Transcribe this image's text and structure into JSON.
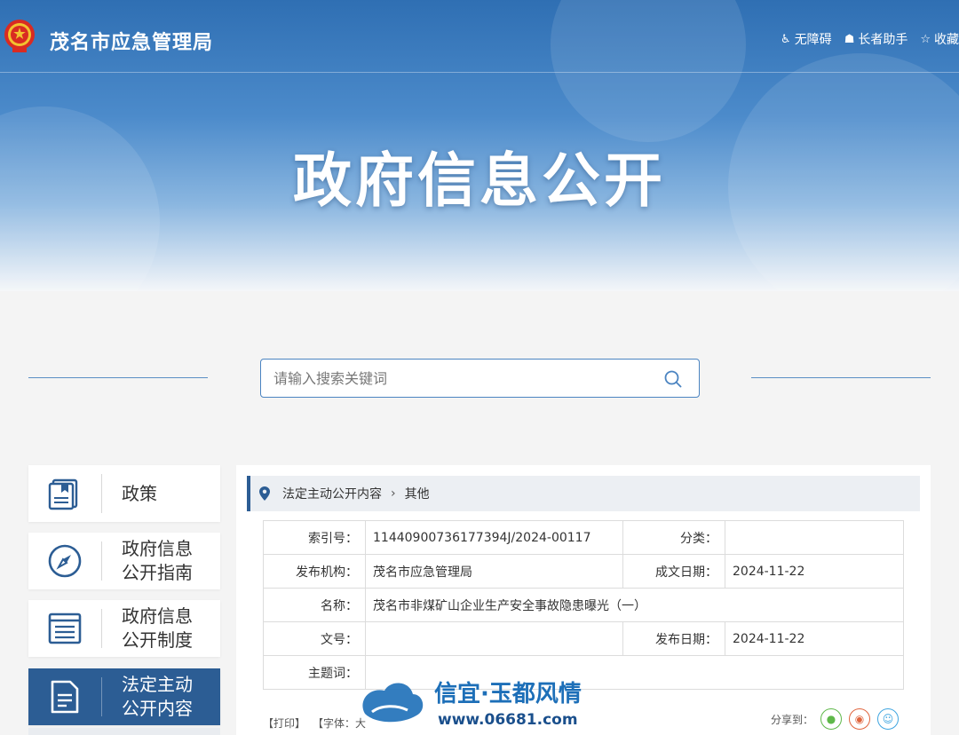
{
  "header": {
    "site_name": "茂名市应急管理局",
    "tools": [
      {
        "icon": "wheelchair-icon",
        "label": "无障碍"
      },
      {
        "icon": "elder-helper-icon",
        "label": "长者助手"
      },
      {
        "icon": "star-icon",
        "label": "收藏"
      }
    ]
  },
  "banner": {
    "title": "政府信息公开"
  },
  "search": {
    "placeholder": "请输入搜索关键词"
  },
  "sidebar": {
    "items": [
      {
        "label": "政策",
        "icon": "policy-book-icon"
      },
      {
        "label": "政府信息公开指南",
        "line1": "政府信息",
        "line2": "公开指南",
        "icon": "compass-icon"
      },
      {
        "label": "政府信息公开制度",
        "line1": "政府信息",
        "line2": "公开制度",
        "icon": "list-doc-icon"
      },
      {
        "label": "法定主动公开内容",
        "line1": "法定主动",
        "line2": "公开内容",
        "icon": "document-icon",
        "active": true
      }
    ]
  },
  "breadcrumb": {
    "level1": "法定主动公开内容",
    "level2": "其他"
  },
  "meta": {
    "index_label": "索引号：",
    "index_value": "11440900736177394J/2024-00117",
    "category_label": "分类：",
    "category_value": "",
    "publisher_label": "发布机构：",
    "publisher_value": "茂名市应急管理局",
    "created_label": "成文日期：",
    "created_value": "2024-11-22",
    "name_label": "名称：",
    "name_value": "茂名市非煤矿山企业生产安全事故隐患曝光（一）",
    "docno_label": "文号：",
    "docno_value": "",
    "published_label": "发布日期：",
    "published_value": "2024-11-22",
    "subject_label": "主题词：",
    "subject_value": ""
  },
  "footer": {
    "print": "【打印】",
    "font": "【字体：大",
    "share_label": "分享到："
  },
  "watermark": {
    "line1": "信宜·玉都风情",
    "line2": "www.06681.com"
  },
  "colors": {
    "accent": "#2c5d94",
    "banner": "#4c8bcb"
  }
}
